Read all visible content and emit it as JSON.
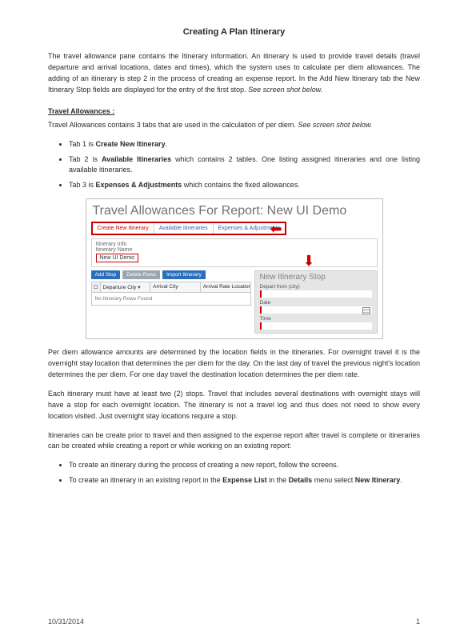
{
  "title": "Creating A Plan Itinerary",
  "intro": "The travel allowance pane contains the Itinerary information. An itinerary is used to provide travel details (travel departure and arrival locations, dates and times), which the system uses to calculate per diem allowances. The adding of an itinerary is step 2 in the process of creating an expense report. In the Add New Itinerary tab the New Itinerary Stop fields are displayed for the entry of the first stop.",
  "intro_tail_italic": "See screen shot below.",
  "ta_head": "Travel Allowances :",
  "ta_intro": "Travel Allowances contains 3 tabs that are used in the calculation of per diem.",
  "ta_intro_tail_italic": "See screen shot below.",
  "tabs": [
    {
      "prefix": "Tab 1 is ",
      "bold": "Create New Itinerary",
      "suffix": "."
    },
    {
      "prefix": "Tab 2 is ",
      "bold": "Available Itineraries",
      "suffix": " which contains 2 tables. One listing assigned itineraries and one listing available itineraries."
    },
    {
      "prefix": "Tab 3 is ",
      "bold": "Expenses & Adjustments",
      "suffix": " which contains the fixed allowances."
    }
  ],
  "shot": {
    "title": "Travel Allowances For Report: New UI Demo",
    "tabs": [
      "Create New Itinerary",
      "Available Itineraries",
      "Expenses & Adjustments"
    ],
    "itin_label": "Itinerary Info",
    "name_label": "Itinerary Name",
    "name_value": "New UI Demo",
    "buttons": [
      "Add Stop",
      "Delete Rows",
      "Import Itinerary"
    ],
    "cols": [
      "Departure City ▾",
      "Arrival City",
      "Arrival Rate Location"
    ],
    "empty_row": "No Itinerary Rows Found",
    "right_heading": "New Itinerary Stop",
    "fields": [
      "Depart from (city)",
      "Date",
      "Time"
    ]
  },
  "para2": "Per diem allowance amounts are determined by the location fields in the itineraries. For overnight travel it is the overnight stay location that determines the per diem for the day. On the last day of travel the previous night's location determines the per diem. For one day travel the destination location determines the per diem rate.",
  "para3": "Each itinerary must have at least two (2) stops. Travel that includes several destinations with overnight stays will have a stop for each overnight location. The itinerary is not a travel log and thus does not need to show every location visited. Just overnight stay locations require a stop.",
  "para4": "Itineraries can be create prior to travel and then assigned to the expense report after travel is complete or itineraries can be created while creating a report or while working on an existing report:",
  "bullets2": [
    {
      "text": "To create an itinerary during the process of creating a new report, follow the screens."
    },
    {
      "prefix": "To create an itinerary in an existing report in the ",
      "b1": "Expense List",
      "mid": " in the ",
      "b2": "Details",
      "mid2": " menu select ",
      "b3": "New Itinerary",
      "suffix": "."
    }
  ],
  "footer_date": "10/31/2014",
  "footer_page": "1"
}
